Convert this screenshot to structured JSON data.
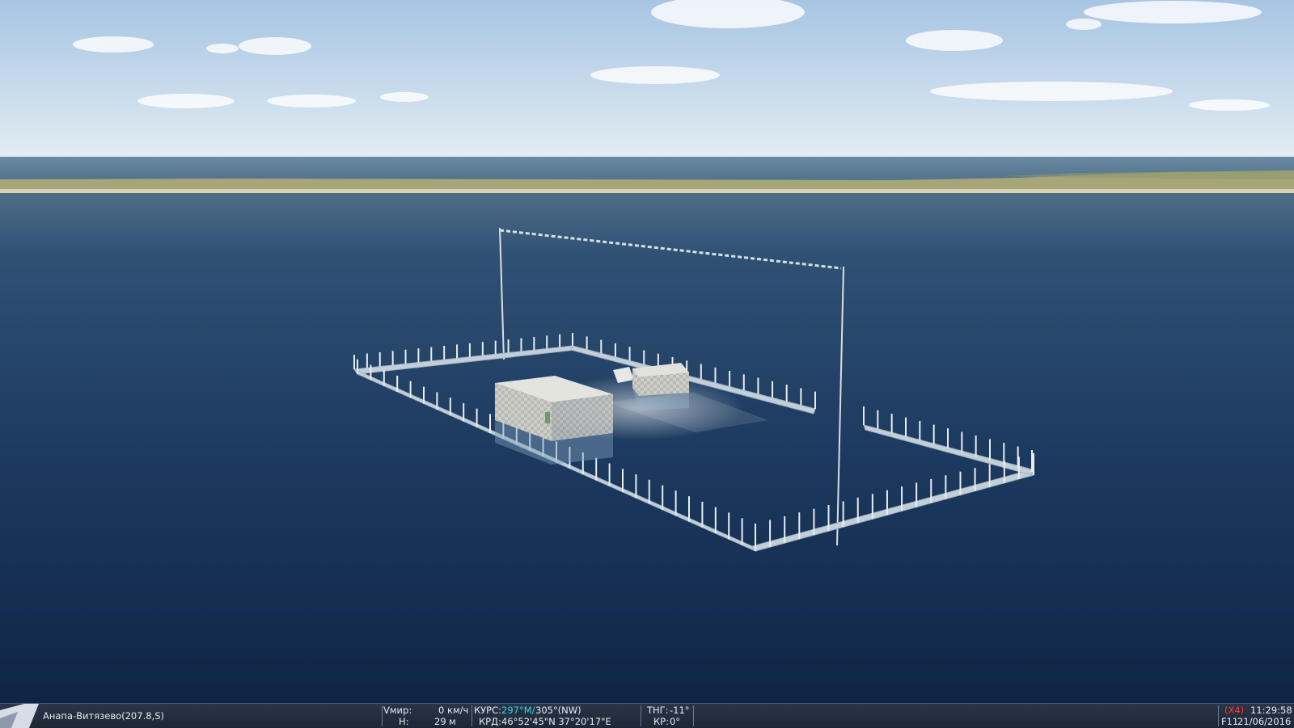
{
  "status": {
    "airfield": "Анапа-Витязево(207.8,S)",
    "speed_label": "Vмир:",
    "speed_value": "0",
    "speed_unit": "км/ч",
    "alt_label": "Н:",
    "alt_value": "29",
    "alt_unit": "м",
    "heading_label": "КУРС:",
    "heading_mag": "297°М/",
    "heading_true": "305°(NW)",
    "coord_label": "КРД:",
    "coord_value": "46°52'45\"N 37°20'17\"E",
    "pitch_label": "ТНГ:",
    "pitch_value": "-11°",
    "roll_label": "КР:",
    "roll_value": "0°",
    "time_accel": "(X4)",
    "clock": "11:29:58",
    "view_key": "F11",
    "date": "21/06/2016"
  },
  "colors": {
    "sky_top": "#a9c7e4",
    "sky_horizon": "#e3edf2",
    "sea_far": "#4d6b86",
    "sea_near": "#10284a",
    "shore": "#a9a77a",
    "fence": "#c9d4dc",
    "heading_accent": "#39d1e6",
    "time_accent": "#ff3b30"
  },
  "icons": [
    "app-logo-icon"
  ]
}
